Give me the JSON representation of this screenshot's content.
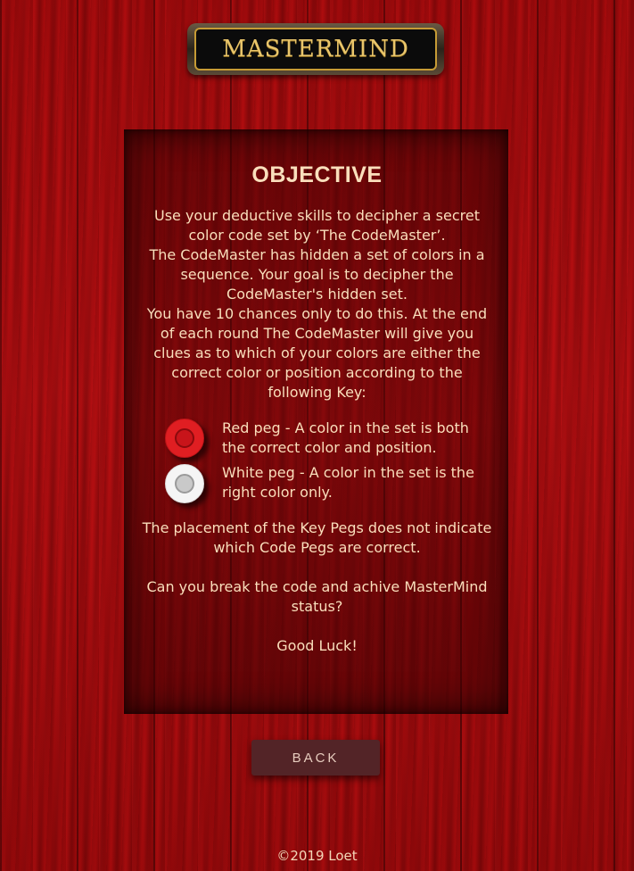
{
  "logo": {
    "text": "MASTERMIND",
    "gem_colors": [
      "#2ec44a",
      "#e8d01e",
      "#3a55e0",
      "#e02a2a"
    ]
  },
  "objective": {
    "title": "OBJECTIVE",
    "intro_lines": [
      "Use your deductive skills to decipher a secret",
      "color code set by ‘The CodeMaster’.",
      "The CodeMaster has hidden a set of colors in a",
      "sequence. Your goal is to decipher the",
      "CodeMaster's hidden set.",
      "You have 10 chances only to do this. At the end",
      "of each round The CodeMaster will give you",
      "clues as to which of your colors are either the",
      "correct color or position according to the",
      "following Key:"
    ],
    "key": [
      {
        "peg": "red-peg-icon",
        "lines": [
          "Red peg - A color in the set is both",
          "the correct color and position."
        ]
      },
      {
        "peg": "white-peg-icon",
        "lines": [
          "White peg - A color in the set is the",
          "right color only."
        ]
      }
    ],
    "placement_note_lines": [
      "The placement of the Key Pegs does not indicate",
      "which Code Pegs are correct."
    ],
    "question_lines": [
      "Can you break the code and achive MasterMind",
      "status?"
    ],
    "sign_off": "Good Luck!"
  },
  "back_button": {
    "label": "BACK"
  },
  "footer": {
    "copyright": "©2019  Loet"
  },
  "colors": {
    "background_red": "#a3090b",
    "text_cream": "#fadfbc",
    "button_bg": "#532427",
    "peg_red": "#e01e22",
    "peg_white": "#f5f5f5"
  }
}
